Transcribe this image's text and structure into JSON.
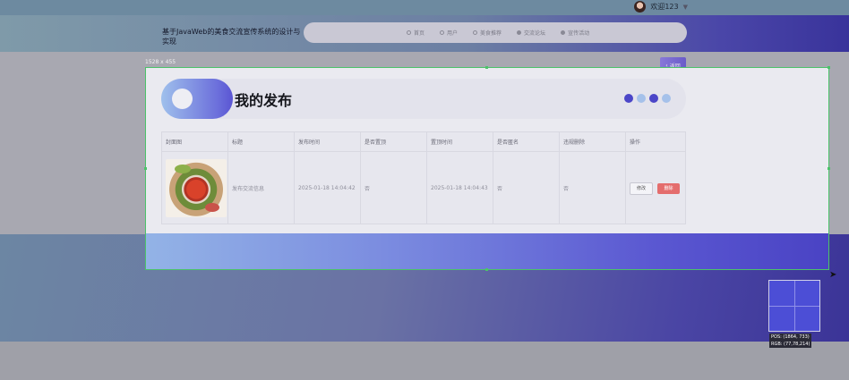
{
  "topbar": {
    "welcome": "欢迎123",
    "caret": "▼"
  },
  "header": {
    "site_title": "基于JavaWeb的美食交流宣传系统的设计与实现",
    "nav": [
      {
        "label": "首页",
        "icon": "home-icon"
      },
      {
        "label": "用户",
        "icon": "user-icon"
      },
      {
        "label": "美食推荐",
        "icon": "recommend-icon"
      },
      {
        "label": "交流论坛",
        "icon": "forum-icon"
      },
      {
        "label": "宣传活动",
        "icon": "activity-icon"
      }
    ]
  },
  "overlay": {
    "size_label": "1528 x 455",
    "back_label": "返回",
    "back_icon": "‹"
  },
  "panel": {
    "title": "我的发布",
    "dot_colors": [
      "#4b46c8",
      "#a5c1ea",
      "#4b46c8",
      "#a5c1ea"
    ]
  },
  "table": {
    "headers": [
      "封面图",
      "标题",
      "发布时间",
      "是否置顶",
      "置顶时间",
      "是否匿名",
      "违规删除",
      "操作"
    ],
    "rows": [
      {
        "title": "发布交流信息",
        "publish_time": "2025-01-18 14:04:42",
        "is_top": "否",
        "top_time": "2025-01-18 14:04:43",
        "is_anonymous": "否",
        "violation_deleted": "否",
        "edit_label": "修改",
        "delete_label": "删除"
      }
    ]
  },
  "magnifier": {
    "pos": "POS:   (1864, 733)",
    "rgb": "RGB:   (77,78,214)"
  }
}
